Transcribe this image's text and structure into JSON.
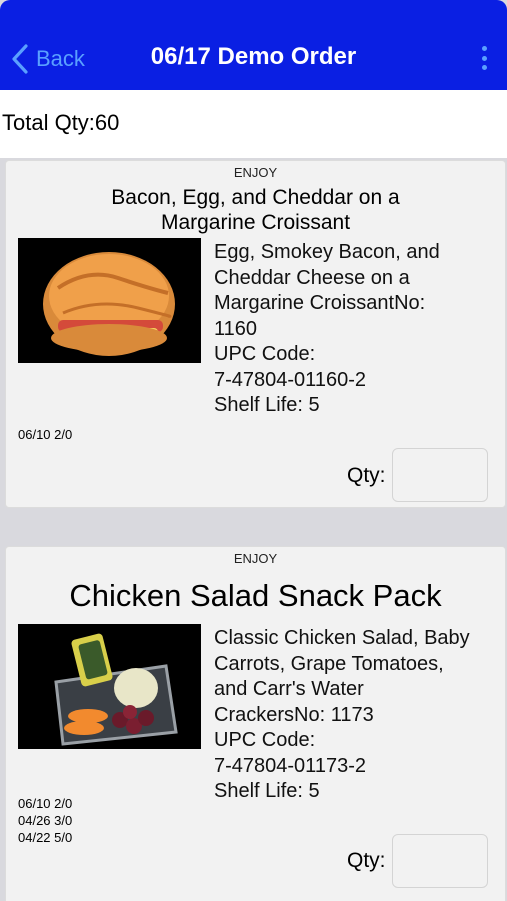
{
  "nav": {
    "back_label": "Back",
    "title": "06/17 Demo Order"
  },
  "total_qty_label": "Total Qty:60",
  "products": [
    {
      "brand": "ENJOY",
      "name_lines": [
        "Bacon, Egg, and Cheddar on a",
        "Margarine Croissant"
      ],
      "image": "croissant-sandwich",
      "desc_lines": [
        "Egg, Smokey Bacon, and",
        "Cheddar Cheese on a",
        "Margarine CroissantNo:",
        "1160",
        "UPC Code:",
        "7-47804-01160-2",
        "Shelf Life: 5"
      ],
      "history": [
        "06/10 2/0"
      ],
      "qty_label": "Qty:",
      "qty_value": ""
    },
    {
      "brand": "ENJOY",
      "name_lines": [
        "Chicken Salad Snack Pack"
      ],
      "image": "snack-pack-tray",
      "desc_lines": [
        "Classic Chicken Salad, Baby",
        "Carrots, Grape Tomatoes,",
        "and Carr's Water",
        "CrackersNo: 1173",
        "UPC Code:",
        "7-47804-01173-2",
        "Shelf Life: 5"
      ],
      "history": [
        "06/10 2/0",
        "04/26 3/0",
        "04/22 5/0"
      ],
      "qty_label": "Qty:",
      "qty_value": ""
    }
  ]
}
